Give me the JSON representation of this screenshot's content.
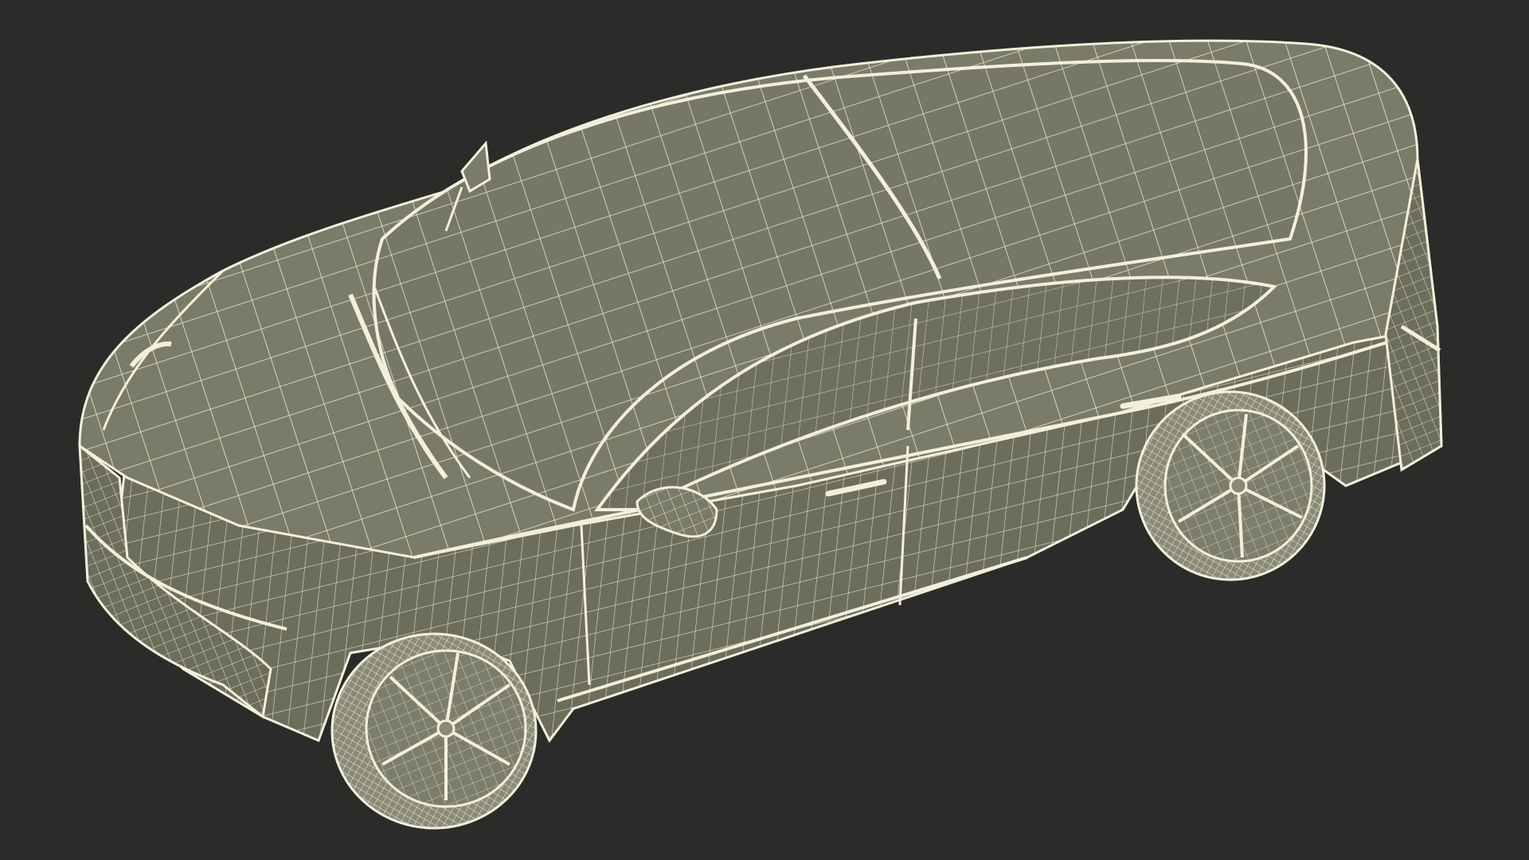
{
  "scene": {
    "subject": "car-wireframe",
    "background_color": "#2b2b2a",
    "body_fill": "#7b7b69",
    "body_fill_dark": "#6a6a5a",
    "glass_fill": "#77776a",
    "wire_color": "#f2f0dc",
    "wheel_fill": "#8a8a78"
  }
}
